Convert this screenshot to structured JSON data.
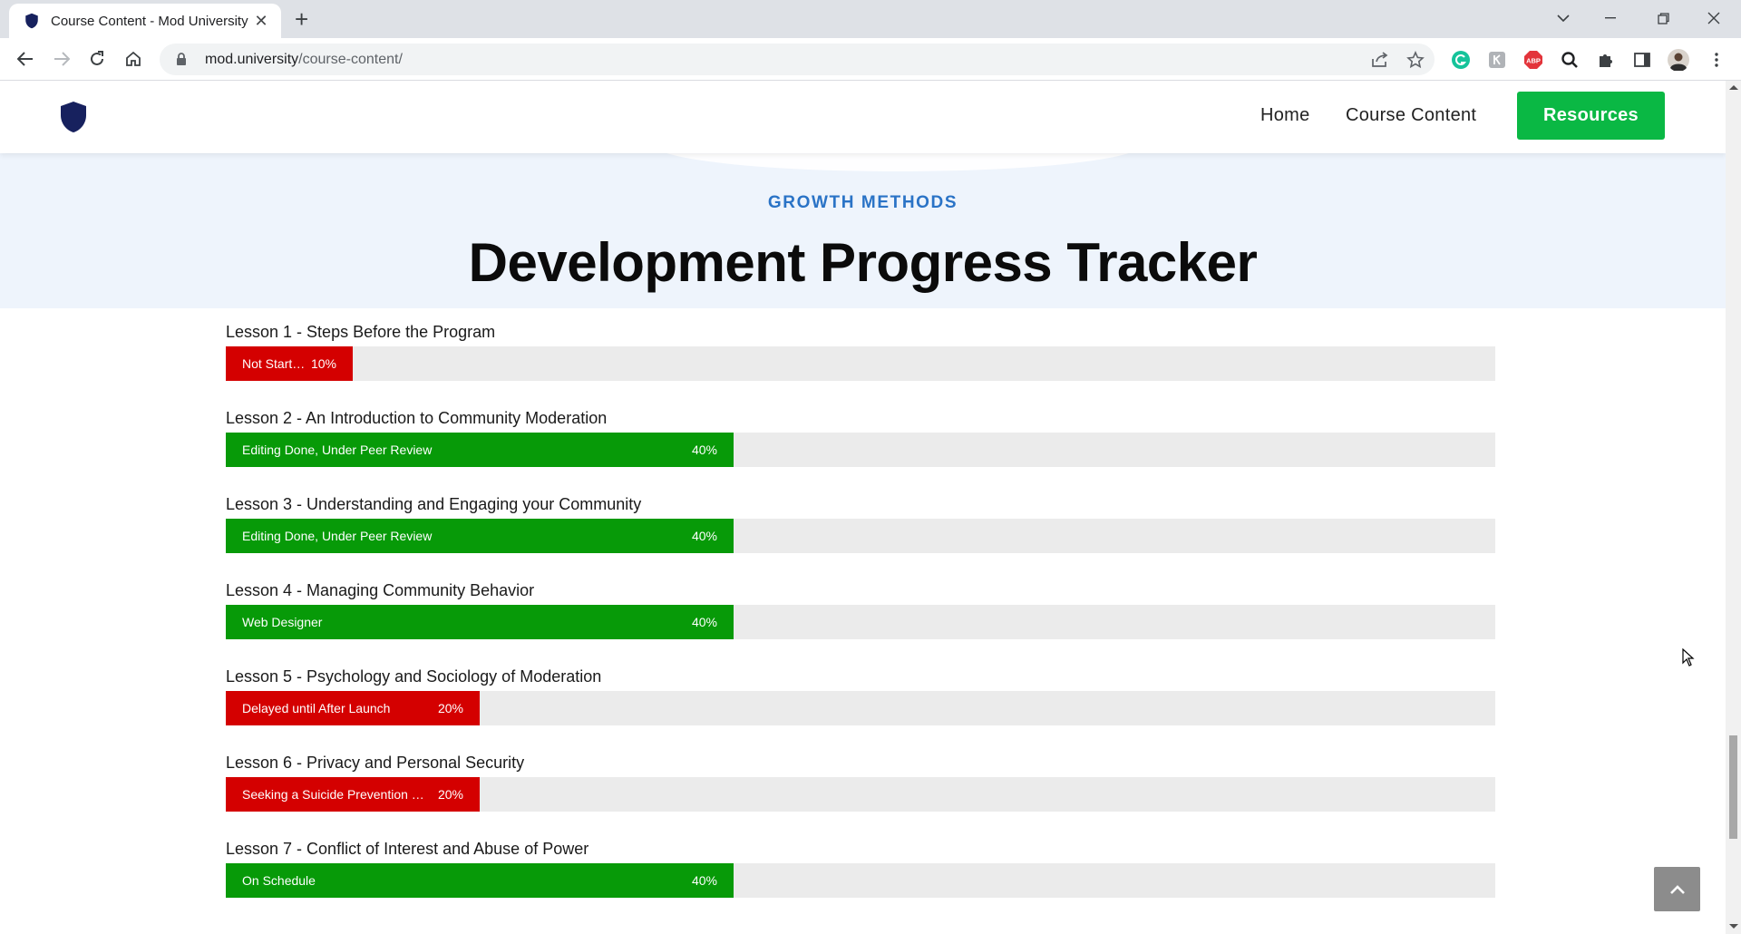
{
  "browser": {
    "tab_title": "Course Content - Mod University",
    "url_host": "mod.university",
    "url_path": "/course-content/"
  },
  "site": {
    "nav": {
      "home": "Home",
      "course_content": "Course Content",
      "resources": "Resources"
    },
    "hero": {
      "eyebrow": "GROWTH METHODS",
      "title": "Development Progress Tracker"
    },
    "lessons": [
      {
        "title": "Lesson 1 - Steps Before the Program",
        "status": "Not Started",
        "percent": "10%",
        "progress": 0.1,
        "color": "#d40000"
      },
      {
        "title": "Lesson 2 - An Introduction to Community Moderation",
        "status": "Editing Done, Under Peer Review",
        "percent": "40%",
        "progress": 0.4,
        "color": "#079a08"
      },
      {
        "title": "Lesson 3 - Understanding and Engaging your Community",
        "status": "Editing Done, Under Peer Review",
        "percent": "40%",
        "progress": 0.4,
        "color": "#079a08"
      },
      {
        "title": "Lesson 4 - Managing Community Behavior",
        "status": "Web Designer",
        "percent": "40%",
        "progress": 0.4,
        "color": "#079a08"
      },
      {
        "title": "Lesson 5 - Psychology and Sociology of Moderation",
        "status": "Delayed until After Launch",
        "percent": "20%",
        "progress": 0.2,
        "color": "#d40000"
      },
      {
        "title": "Lesson 6 - Privacy and Personal Security",
        "status": "Seeking a Suicide Prevention Ex...",
        "percent": "20%",
        "progress": 0.2,
        "color": "#d40000"
      },
      {
        "title": "Lesson 7 - Conflict of Interest and Abuse of Power",
        "status": "On Schedule",
        "percent": "40%",
        "progress": 0.4,
        "color": "#079a08"
      }
    ],
    "colors": {
      "resources_button": "#0ab844",
      "eyebrow": "#2a73c6",
      "hero_bg": "#eef4fc",
      "track": "#ebebeb"
    }
  }
}
